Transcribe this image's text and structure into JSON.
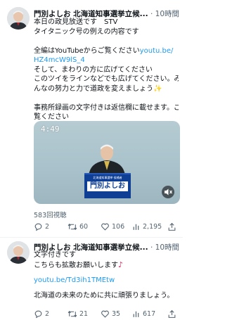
{
  "tweet1": {
    "display_name": "門別よしお 北海道知事選挙立候...",
    "time": "· 10時間",
    "lines": [
      "本日の政見放送です　STV",
      "タイタニック号の例えの内容です",
      "",
      "全編はYouTubeからご覧ください",
      "",
      "そして、まわりの方に広げてください",
      "このツイをラインなどでも広げてください。み",
      "んなの努力と力で道政を変えましょう",
      "",
      "事務所録画の文字付きは返信欄に載せます。ご",
      "覧ください"
    ],
    "link_part1": "youtu.be/",
    "link_part2": "HZ4mcW9lS_4",
    "video": {
      "timestamp": "4:49",
      "podium_text_small": "北海道知事選挙 候補者",
      "podium_name": "門別よしお"
    },
    "views": "583回視聴",
    "stats": {
      "replies": "2",
      "retweets": "60",
      "likes": "106",
      "views": "2,195"
    }
  },
  "tweet2": {
    "display_name": "門別よしお 北海道知事選挙立候...",
    "time": "· 10時間",
    "line1": "文字付きです",
    "line2": "こちらも拡散お願いします",
    "link": "youtu.be/Td3ih1TMEtw",
    "line3": "北海道の未来のために共に頑張りましょう。",
    "stats": {
      "replies": "2",
      "retweets": "21",
      "likes": "35",
      "views": "617"
    }
  },
  "colors": {
    "link": "#1d9bf0",
    "muted": "#536471",
    "podium_blue": "#0f3f95"
  }
}
